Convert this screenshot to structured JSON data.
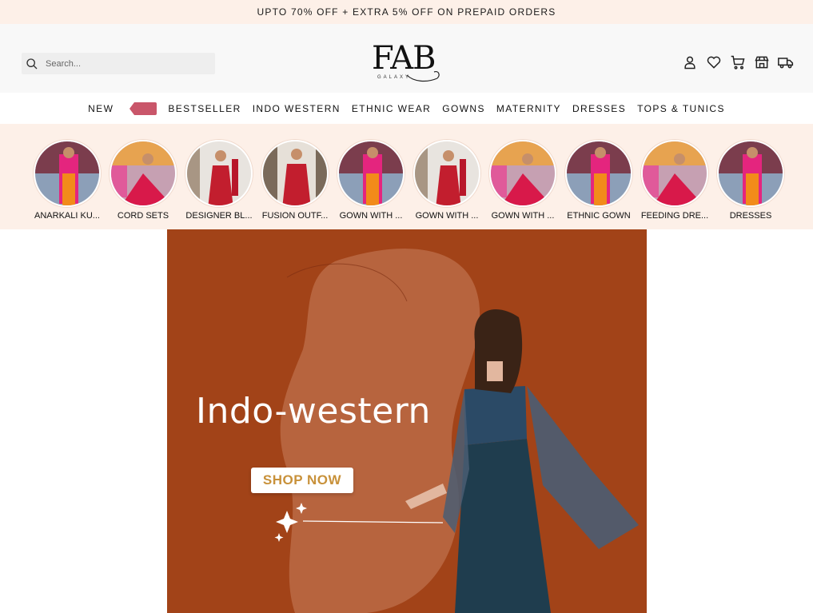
{
  "announcement": "UPTO 70% OFF + EXTRA 5% OFF ON PREPAID ORDERS",
  "search": {
    "placeholder": "Search..."
  },
  "logo": {
    "text": "FAB",
    "sub": "GALAXY"
  },
  "header_icons": [
    "user-icon",
    "heart-icon",
    "cart-icon",
    "store-icon",
    "truck-icon"
  ],
  "nav": {
    "items": [
      "NEW",
      "BESTSELLER",
      "INDO WESTERN",
      "ETHNIC WEAR",
      "GOWNS",
      "MATERNITY",
      "DRESSES",
      "TOPS & TUNICS"
    ],
    "tag_color": "#c9566a"
  },
  "stories": [
    {
      "label": "ANARKALI KU..."
    },
    {
      "label": "CORD SETS"
    },
    {
      "label": "DESIGNER BL..."
    },
    {
      "label": "FUSION OUTF..."
    },
    {
      "label": "GOWN WITH ..."
    },
    {
      "label": "GOWN WITH ..."
    },
    {
      "label": "GOWN WITH ..."
    },
    {
      "label": "ETHNIC GOWN"
    },
    {
      "label": "FEEDING DRE..."
    },
    {
      "label": "DRESSES"
    }
  ],
  "banner": {
    "title": "Indo-western",
    "cta": "SHOP NOW",
    "bg_color": "#a24318",
    "cta_color": "#c8913a"
  }
}
